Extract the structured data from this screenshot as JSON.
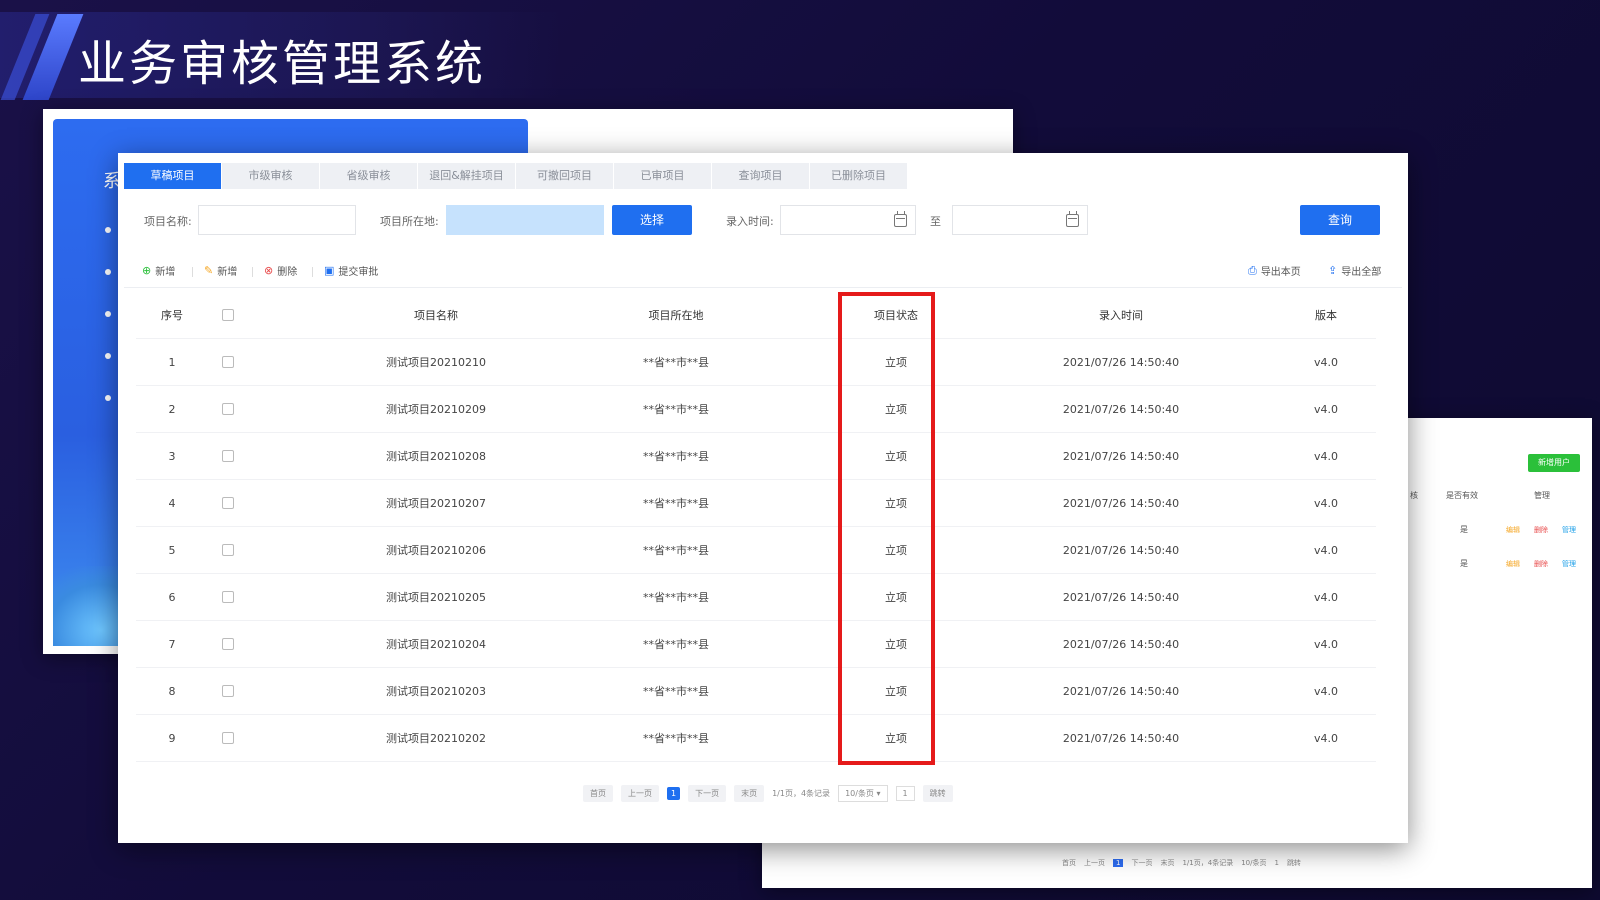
{
  "page": {
    "title": "业务审核管理系统"
  },
  "back_panel": {
    "title_fragment": "系"
  },
  "right_panel": {
    "add_user_label": "新增用户",
    "headers": [
      "核",
      "是否有效",
      "管理"
    ],
    "rows": [
      {
        "valid": "是",
        "actions": [
          "编辑",
          "删除",
          "管理"
        ]
      },
      {
        "valid": "是",
        "actions": [
          "编辑",
          "删除",
          "管理"
        ]
      }
    ],
    "pager": [
      "首页",
      "上一页",
      "1",
      "下一页",
      "末页",
      "1/1页，4条记录",
      "10/条页",
      "1",
      "跳转"
    ]
  },
  "tabs": [
    {
      "label": "草稿项目",
      "active": true
    },
    {
      "label": "市级审核"
    },
    {
      "label": "省级审核"
    },
    {
      "label": "退回&解挂项目"
    },
    {
      "label": "可撤回项目"
    },
    {
      "label": "已审项目"
    },
    {
      "label": "查询项目"
    },
    {
      "label": "已删除项目"
    }
  ],
  "filter": {
    "name_label": "项目名称:",
    "location_label": "项目所在地:",
    "select_btn": "选择",
    "time_label": "录入时间:",
    "to_label": "至",
    "query_btn": "查询"
  },
  "toolbar": {
    "add1": "新增",
    "add2": "新增",
    "delete": "删除",
    "submit": "提交审批",
    "export_page": "导出本页",
    "export_all": "导出全部"
  },
  "table": {
    "columns": [
      "序号",
      "",
      "项目名称",
      "项目所在地",
      "项目状态",
      "录入时间",
      "版本"
    ],
    "rows": [
      {
        "no": "1",
        "name": "测试项目20210210",
        "loc": "**省**市**县",
        "status": "立项",
        "time": "2021/07/26 14:50:40",
        "ver": "v4.0"
      },
      {
        "no": "2",
        "name": "测试项目20210209",
        "loc": "**省**市**县",
        "status": "立项",
        "time": "2021/07/26 14:50:40",
        "ver": "v4.0"
      },
      {
        "no": "3",
        "name": "测试项目20210208",
        "loc": "**省**市**县",
        "status": "立项",
        "time": "2021/07/26 14:50:40",
        "ver": "v4.0"
      },
      {
        "no": "4",
        "name": "测试项目20210207",
        "loc": "**省**市**县",
        "status": "立项",
        "time": "2021/07/26 14:50:40",
        "ver": "v4.0"
      },
      {
        "no": "5",
        "name": "测试项目20210206",
        "loc": "**省**市**县",
        "status": "立项",
        "time": "2021/07/26 14:50:40",
        "ver": "v4.0"
      },
      {
        "no": "6",
        "name": "测试项目20210205",
        "loc": "**省**市**县",
        "status": "立项",
        "time": "2021/07/26 14:50:40",
        "ver": "v4.0"
      },
      {
        "no": "7",
        "name": "测试项目20210204",
        "loc": "**省**市**县",
        "status": "立项",
        "time": "2021/07/26 14:50:40",
        "ver": "v4.0"
      },
      {
        "no": "8",
        "name": "测试项目20210203",
        "loc": "**省**市**县",
        "status": "立项",
        "time": "2021/07/26 14:50:40",
        "ver": "v4.0"
      },
      {
        "no": "9",
        "name": "测试项目20210202",
        "loc": "**省**市**县",
        "status": "立项",
        "time": "2021/07/26 14:50:40",
        "ver": "v4.0"
      }
    ]
  },
  "pager": {
    "first": "首页",
    "prev": "上一页",
    "current": "1",
    "next": "下一页",
    "last": "末页",
    "info": "1/1页，4条记录",
    "page_size": "10/条页",
    "jump_value": "1",
    "jump": "跳转"
  },
  "colors": {
    "primary": "#1f6ff0",
    "highlight": "#e51a1a",
    "success": "#2bc03a"
  }
}
